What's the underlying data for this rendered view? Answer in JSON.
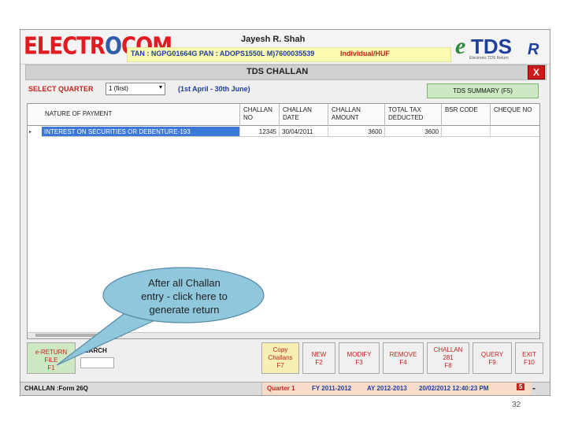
{
  "brand": {
    "logo_left_a": "ELECTR",
    "logo_left_o": "O",
    "logo_left_b": "COM",
    "user_name": "Jayesh R. Shah",
    "tan_pan_mob": "TAN : NGPG01664G  PAN : ADOPS1550L  M)7600035539",
    "status_type": "Individual/HUF",
    "logo_right_e": "e",
    "logo_right_tds": "TDS",
    "logo_right_r": "R",
    "logo_right_tag": "Electronic TDS Return"
  },
  "window": {
    "title": "TDS CHALLAN",
    "close_label": "X"
  },
  "quarter": {
    "label": "SELECT QUARTER",
    "selected": "1 (first)",
    "dropdown_arrow": "▾",
    "range": "(1st April - 30th June)",
    "summary_button": "TDS SUMMARY (F5)"
  },
  "grid": {
    "columns": [
      "NATURE OF PAYMENT",
      "CHALLAN NO",
      "CHALLAN DATE",
      "CHALLAN AMOUNT",
      "TOTAL TAX DEDUCTED",
      "BSR CODE",
      "CHEQUE NO"
    ],
    "row_marker": "▸",
    "rows": [
      [
        "INTEREST ON SECURITIES OR DEBENTURE-193",
        "12345",
        "30/04/2011",
        "3600",
        "3600",
        "",
        ""
      ]
    ]
  },
  "buttons": {
    "ereturn": [
      "e-RETURN",
      "FILE",
      "F1"
    ],
    "search_label": "SEARCH",
    "copy": [
      "Copy",
      "Challans",
      "F7"
    ],
    "new": [
      "NEW",
      "F2"
    ],
    "modify": [
      "MODIFY",
      "F3"
    ],
    "remove": [
      "REMOVE",
      "F4"
    ],
    "challan281": [
      "CHALLAN",
      "281",
      "F8"
    ],
    "query": [
      "QUERY",
      "F9"
    ],
    "exit": [
      "EXIT",
      "F10"
    ]
  },
  "statusbar": {
    "form": "CHALLAN :Form 26Q",
    "quarter": "Quarter 1",
    "fy": "FY 2011-2012",
    "ay": "AY 2012-2013",
    "datetime": "20/02/2012 12:40:23 PM",
    "count": "5",
    "dash": "-"
  },
  "callout": {
    "line1": "After all Challan",
    "line2": "entry - click here to",
    "line3": "generate return"
  },
  "slide": {
    "page_number": "32"
  },
  "colors": {
    "accent_red": "#c0261d",
    "accent_blue": "#1f3f9c",
    "callout_fill": "#8fc7dc",
    "selected_row": "#3b78d8"
  }
}
